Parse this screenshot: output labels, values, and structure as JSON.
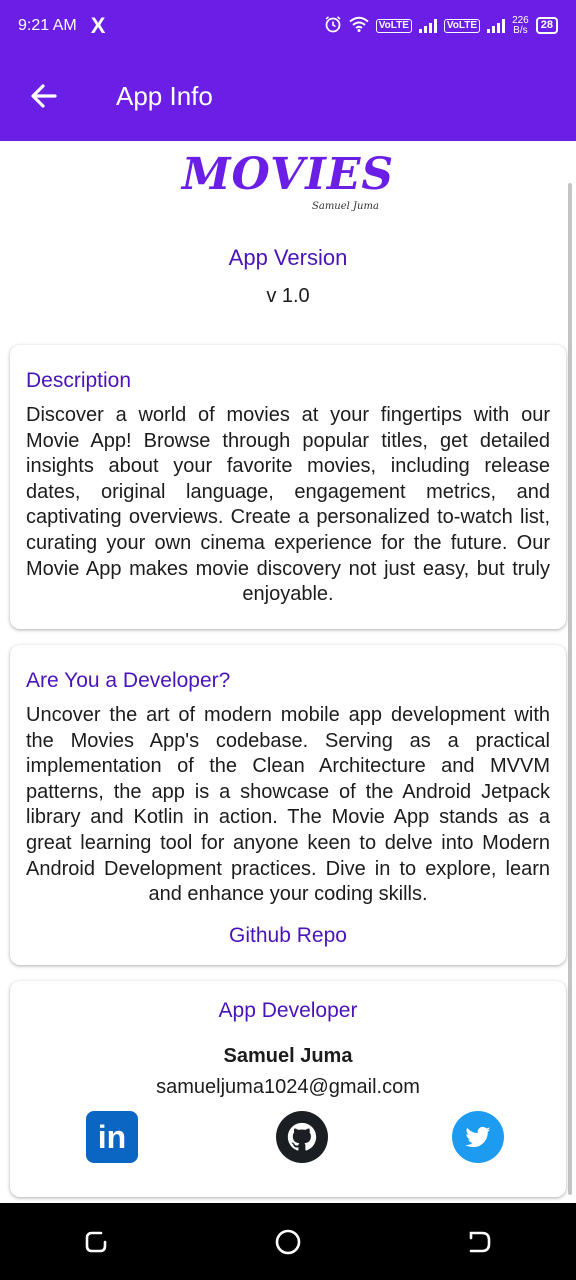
{
  "status_bar": {
    "time": "9:21 AM",
    "x_icon": "X",
    "volte1": "VoLTE",
    "volte2": "VoLTE",
    "speed_value": "226",
    "speed_unit": "B/s",
    "battery": "28"
  },
  "app_bar": {
    "title": "App Info",
    "back_icon": "arrow-left-icon"
  },
  "logo": {
    "text": "MOVIES",
    "signature": "Samuel Juma"
  },
  "version": {
    "label": "App Version",
    "value": "v 1.0"
  },
  "description": {
    "title": "Description",
    "body": "Discover a world of movies at your fingertips with our Movie App! Browse through popular titles, get detailed insights about your favorite movies, including release dates, original language, engagement metrics, and captivating overviews. Create a personalized to-watch list, curating your own cinema experience for the future. Our Movie App makes movie discovery not just easy, but truly enjoyable."
  },
  "developer": {
    "title": "Are You a Developer?",
    "body": "Uncover the art of modern mobile app development with the Movies App's codebase. Serving as a practical implementation of the Clean Architecture and MVVM patterns, the app is a showcase of the Android Jetpack library and Kotlin in action. The Movie App stands as a great learning tool for anyone keen to delve into Modern Android Development practices. Dive in to explore, learn and enhance your coding skills.",
    "link_label": "Github Repo"
  },
  "author": {
    "title": "App Developer",
    "name": "Samuel Juma",
    "email": "samueljuma1024@gmail.com",
    "linkedin_glyph": "in",
    "social_icons": [
      "linkedin-icon",
      "github-icon",
      "twitter-icon"
    ]
  },
  "colors": {
    "primary": "#6a1ee6",
    "accent_text": "#4a14b8"
  }
}
